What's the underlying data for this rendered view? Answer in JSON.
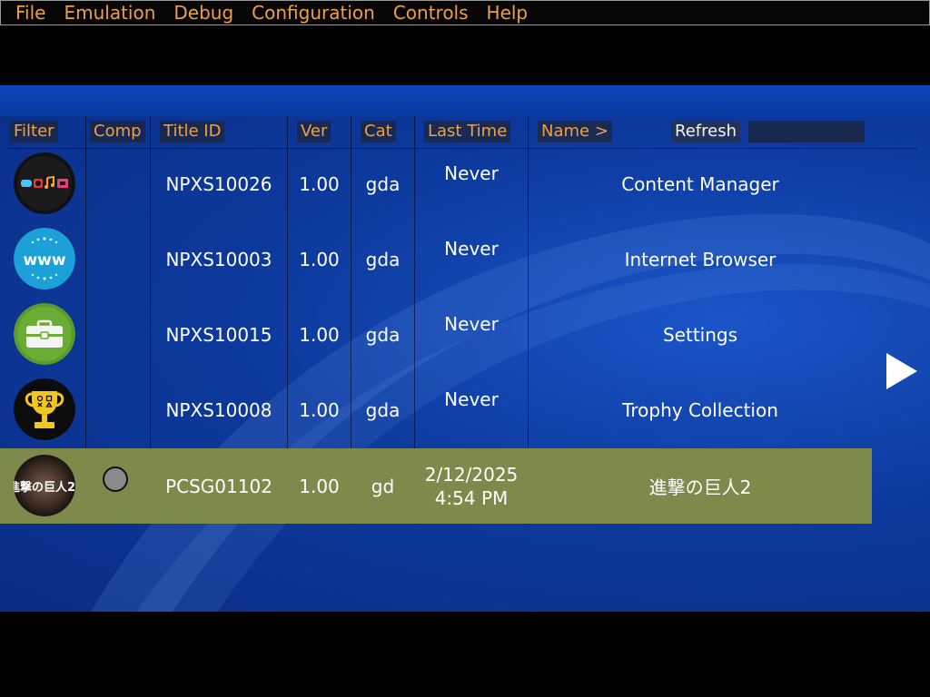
{
  "menu": [
    "File",
    "Emulation",
    "Debug",
    "Configuration",
    "Controls",
    "Help"
  ],
  "headers": {
    "filter": "Filter",
    "comp": "Comp",
    "title_id": "Title ID",
    "ver": "Ver",
    "cat": "Cat",
    "last_time": "Last Time",
    "name": "Name >",
    "refresh": "Refresh"
  },
  "apps": [
    {
      "icon": "content-manager-icon",
      "title_id": "NPXS10026",
      "ver": "1.00",
      "cat": "gda",
      "last_time": "Never",
      "name": "Content Manager",
      "selected": false
    },
    {
      "icon": "internet-browser-icon",
      "title_id": "NPXS10003",
      "ver": "1.00",
      "cat": "gda",
      "last_time": "Never",
      "name": "Internet Browser",
      "selected": false
    },
    {
      "icon": "settings-toolbox-icon",
      "title_id": "NPXS10015",
      "ver": "1.00",
      "cat": "gda",
      "last_time": "Never",
      "name": "Settings",
      "selected": false
    },
    {
      "icon": "trophy-icon",
      "title_id": "NPXS10008",
      "ver": "1.00",
      "cat": "gda",
      "last_time": "Never",
      "name": "Trophy Collection",
      "selected": false
    },
    {
      "icon": "attack-on-titan-2-icon",
      "icon_text": "進撃の巨人2",
      "title_id": "PCSG01102",
      "ver": "1.00",
      "cat": "gd",
      "last_time_date": "2/12/2025",
      "last_time_clock": "4:54 PM",
      "name": "進撃の巨人2",
      "selected": true,
      "comp": "gray-circle"
    }
  ],
  "colors": {
    "menu_text": "#f0a040",
    "selected_row": "#7d8a4c",
    "background_blue": "#0d3a9e"
  }
}
